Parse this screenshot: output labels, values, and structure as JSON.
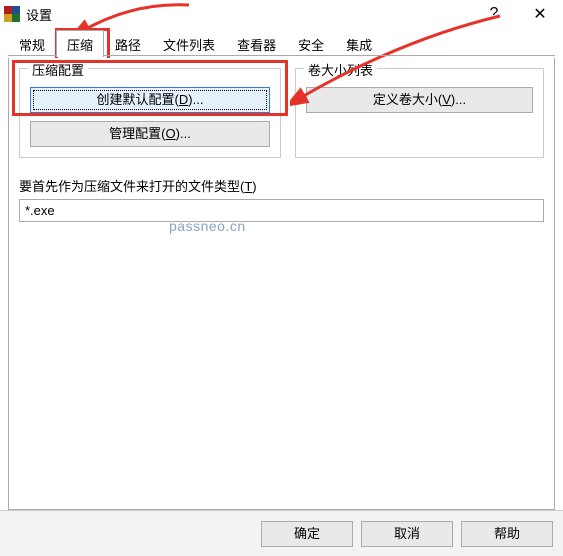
{
  "window": {
    "title": "设置",
    "help_glyph": "?",
    "close_glyph": "✕"
  },
  "tabs": {
    "items": [
      "常规",
      "压缩",
      "路径",
      "文件列表",
      "查看器",
      "安全",
      "集成"
    ],
    "active_index": 1
  },
  "group1": {
    "title": "压缩配置",
    "btn_create": "创建默认配置(",
    "btn_create_key": "D",
    "btn_create_tail": ")...",
    "btn_manage": "管理配置(",
    "btn_manage_key": "O",
    "btn_manage_tail": ")..."
  },
  "group2": {
    "title": "卷大小列表",
    "btn_define": "定义卷大小(",
    "btn_define_key": "V",
    "btn_define_tail": ")..."
  },
  "open_types": {
    "label": "要首先作为压缩文件来打开的文件类型(",
    "label_key": "T",
    "label_tail": ")",
    "value": "*.exe"
  },
  "footer": {
    "ok": "确定",
    "cancel": "取消",
    "help": "帮助"
  },
  "watermark": "passneo.cn"
}
